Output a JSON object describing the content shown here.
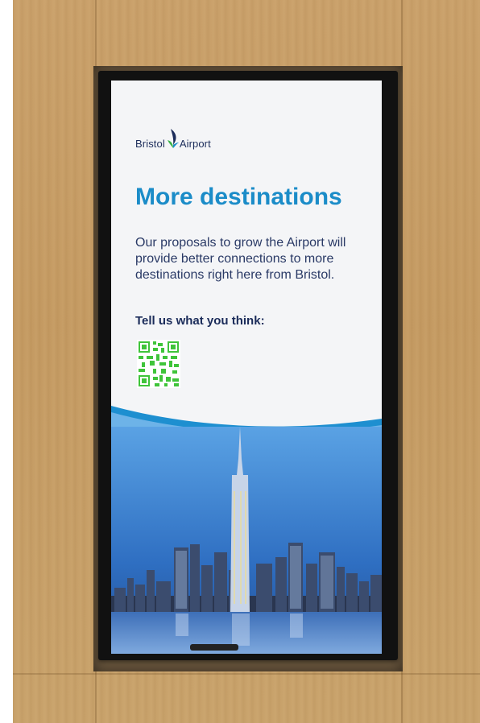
{
  "sign": {
    "logo_left": "Bristol",
    "logo_right": "Airport",
    "headline": "More destinations",
    "body": "Our proposals to grow the Airport will provide better connections to more destinations right here from Bristol.",
    "cta": "Tell us what you think:"
  },
  "colors": {
    "headline_blue": "#1b8cc8",
    "navy_text": "#1b2c5a",
    "qr_green": "#3fc43a",
    "wave_blue": "#1e8fd0",
    "wall_wood": "#c79f68"
  },
  "icons": [
    "bristol-airport-logo-icon",
    "qr-code-icon"
  ]
}
